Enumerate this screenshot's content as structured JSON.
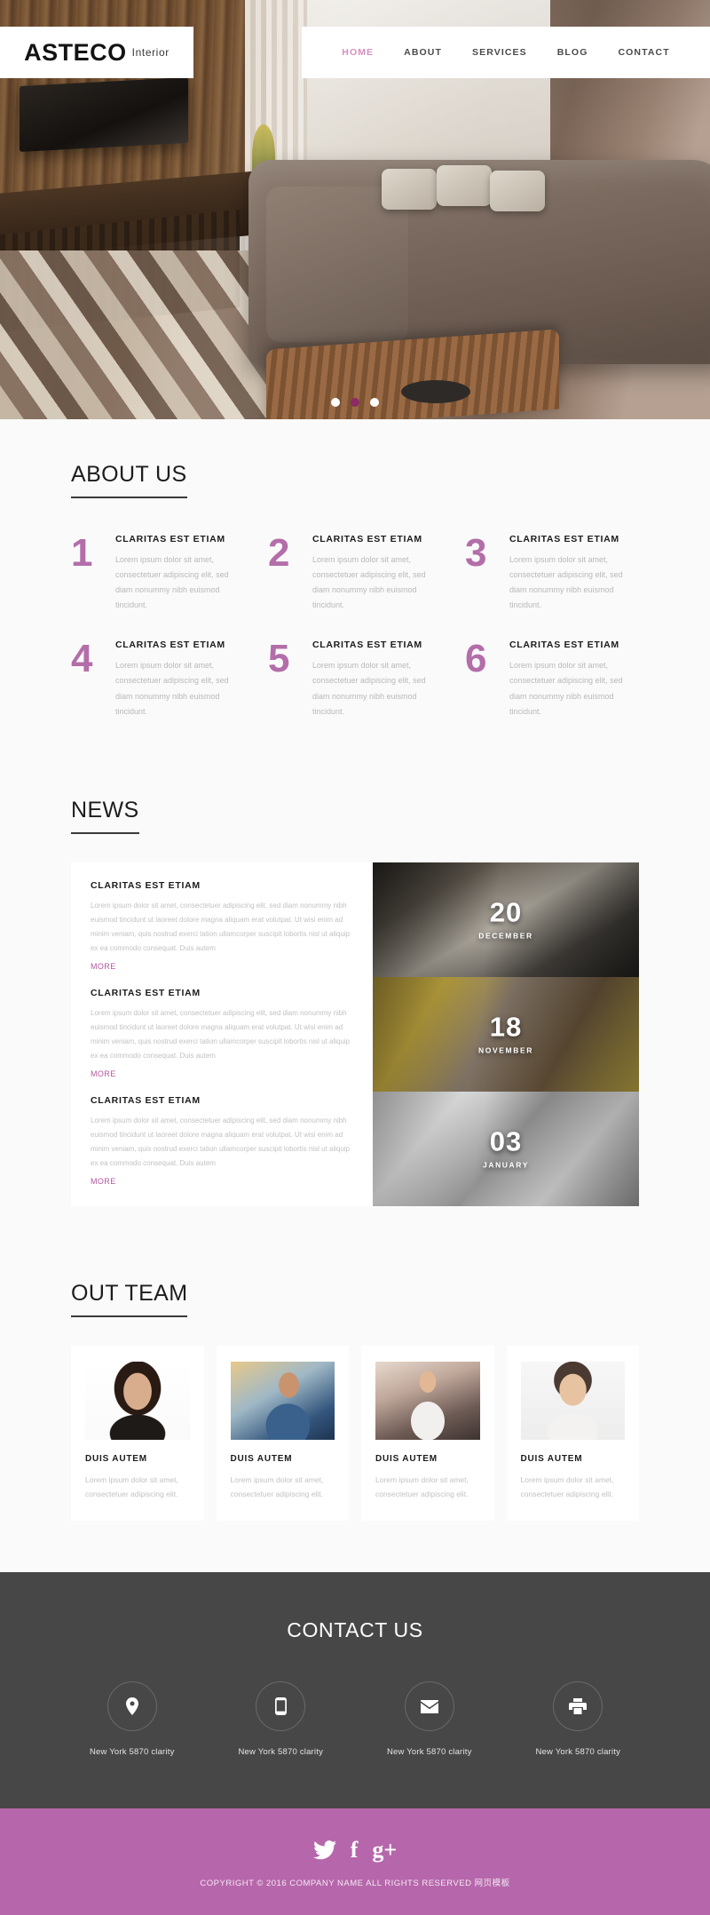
{
  "header": {
    "logo_main": "ASTECO",
    "logo_sub": "Interior",
    "nav": [
      {
        "label": "HOME",
        "active": true
      },
      {
        "label": "ABOUT",
        "active": false
      },
      {
        "label": "SERVICES",
        "active": false
      },
      {
        "label": "BLOG",
        "active": false
      },
      {
        "label": "CONTACT",
        "active": false
      }
    ]
  },
  "hero": {
    "dots": [
      "dot-1",
      "dot-2",
      "dot-3"
    ],
    "active_dot_index": 1
  },
  "about": {
    "title": "ABOUT US",
    "features": [
      {
        "number": "1",
        "heading": "CLARITAS EST ETIAM",
        "text": "Lorem ipsum dolor sit amet, consectetuer adipiscing elit, sed diam nonummy nibh euismod tincidunt."
      },
      {
        "number": "2",
        "heading": "CLARITAS EST ETIAM",
        "text": "Lorem ipsum dolor sit amet, consectetuer adipiscing elit, sed diam nonummy nibh euismod tincidunt."
      },
      {
        "number": "3",
        "heading": "CLARITAS EST ETIAM",
        "text": "Lorem ipsum dolor sit amet, consectetuer adipiscing elit, sed diam nonummy nibh euismod tincidunt."
      },
      {
        "number": "4",
        "heading": "CLARITAS EST ETIAM",
        "text": "Lorem ipsum dolor sit amet, consectetuer adipiscing elit, sed diam nonummy nibh euismod tincidunt."
      },
      {
        "number": "5",
        "heading": "CLARITAS EST ETIAM",
        "text": "Lorem ipsum dolor sit amet, consectetuer adipiscing elit, sed diam nonummy nibh euismod tincidunt."
      },
      {
        "number": "6",
        "heading": "CLARITAS EST ETIAM",
        "text": "Lorem ipsum dolor sit amet, consectetuer adipiscing elit, sed diam nonummy nibh euismod tincidunt."
      }
    ]
  },
  "news": {
    "title": "NEWS",
    "items": [
      {
        "heading": "CLARITAS EST ETIAM",
        "text": "Lorem ipsum dolor sit amet, consectetuer adipiscing elit, sed diam nonummy nibh euismod tincidunt ut laoreet dolore magna aliquam erat volutpat. Ut wisi enim ad minim veniam, quis nostrud exerci tation ullamcorper suscipit lobortis nisl ut aliquip ex ea commodo consequat. Duis autem",
        "more": "MORE"
      },
      {
        "heading": "CLARITAS EST ETIAM",
        "text": "Lorem ipsum dolor sit amet, consectetuer adipiscing elit, sed diam nonummy nibh euismod tincidunt ut laoreet dolore magna aliquam erat volutpat. Ut wisi enim ad minim veniam, quis nostrud exerci tation ullamcorper suscipit lobortis nisl ut aliquip ex ea commodo consequat. Duis autem",
        "more": "MORE"
      },
      {
        "heading": "CLARITAS EST ETIAM",
        "text": "Lorem ipsum dolor sit amet, consectetuer adipiscing elit, sed diam nonummy nibh euismod tincidunt ut laoreet dolore magna aliquam erat volutpat. Ut wisi enim ad minim veniam, quis nostrud exerci tation ullamcorper suscipit lobortis nisl ut aliquip ex ea commodo consequat. Duis autem",
        "more": "MORE"
      }
    ],
    "dates": [
      {
        "day": "20",
        "month": "DECEMBER"
      },
      {
        "day": "18",
        "month": "NOVEMBER"
      },
      {
        "day": "03",
        "month": "JANUARY"
      }
    ]
  },
  "team": {
    "title": "OUT TEAM",
    "members": [
      {
        "name": "DUIS AUTEM",
        "text": "Lorem ipsum dolor sit amet, consectetuer adipiscing elit."
      },
      {
        "name": "DUIS AUTEM",
        "text": "Lorem ipsum dolor sit amet, consectetuer adipiscing elit."
      },
      {
        "name": "DUIS AUTEM",
        "text": "Lorem ipsum dolor sit amet, consectetuer adipiscing elit."
      },
      {
        "name": "DUIS AUTEM",
        "text": "Lorem ipsum dolor sit amet, consectetuer adipiscing elit."
      }
    ]
  },
  "contact": {
    "title": "CONTACT US",
    "items": [
      {
        "icon": "map-pin-icon",
        "label": "New York 5870 clarity"
      },
      {
        "icon": "mobile-phone-icon",
        "label": "New York 5870 clarity"
      },
      {
        "icon": "envelope-icon",
        "label": "New York 5870 clarity"
      },
      {
        "icon": "printer-icon",
        "label": "New York 5870 clarity"
      }
    ]
  },
  "footer": {
    "social": [
      {
        "icon": "twitter-icon",
        "glyph": ""
      },
      {
        "icon": "facebook-icon",
        "glyph": "f"
      },
      {
        "icon": "google-plus-icon",
        "glyph": "g+"
      }
    ],
    "copyright": "COPYRIGHT © 2016 COMPANY NAME ALL RIGHTS RESERVED 网页模板"
  },
  "colors": {
    "accent_purple": "#b667ab",
    "number_purple": "#a7569b",
    "nav_active": "#d98fbe",
    "dark_panel": "#474747",
    "page_bg": "#fafafa"
  }
}
